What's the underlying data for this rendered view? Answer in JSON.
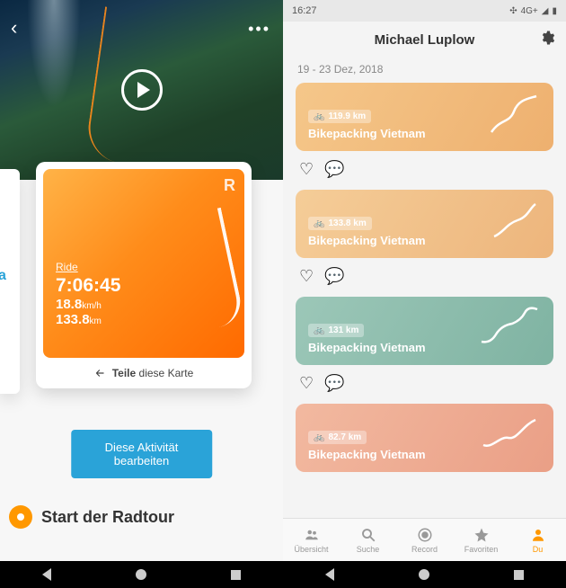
{
  "left": {
    "stats": {
      "type_label": "Ride",
      "time": "7:06:45",
      "speed_value": "18.8",
      "speed_unit": "km/h",
      "distance_value": "133.8",
      "distance_unit": "km"
    },
    "share": {
      "action": "Teile",
      "rest": "diese Karte"
    },
    "edit_button": "Diese Aktivität bearbeiten",
    "start_label": "Start der Radtour"
  },
  "right": {
    "status": {
      "time": "16:27",
      "net": "4G+"
    },
    "header": {
      "title": "Michael Luplow"
    },
    "date_range": "19 - 23 Dez, 2018",
    "trips": [
      {
        "distance": "119.9 km",
        "title": "Bikepacking Vietnam",
        "color": "orange1"
      },
      {
        "distance": "133.8 km",
        "title": "Bikepacking Vietnam",
        "color": "orange2"
      },
      {
        "distance": "131 km",
        "title": "Bikepacking Vietnam",
        "color": "teal"
      },
      {
        "distance": "82.7 km",
        "title": "Bikepacking Vietnam",
        "color": "peach"
      }
    ],
    "tabs": [
      {
        "label": "Übersicht"
      },
      {
        "label": "Suche"
      },
      {
        "label": "Record"
      },
      {
        "label": "Favoriten"
      },
      {
        "label": "Du"
      }
    ]
  }
}
